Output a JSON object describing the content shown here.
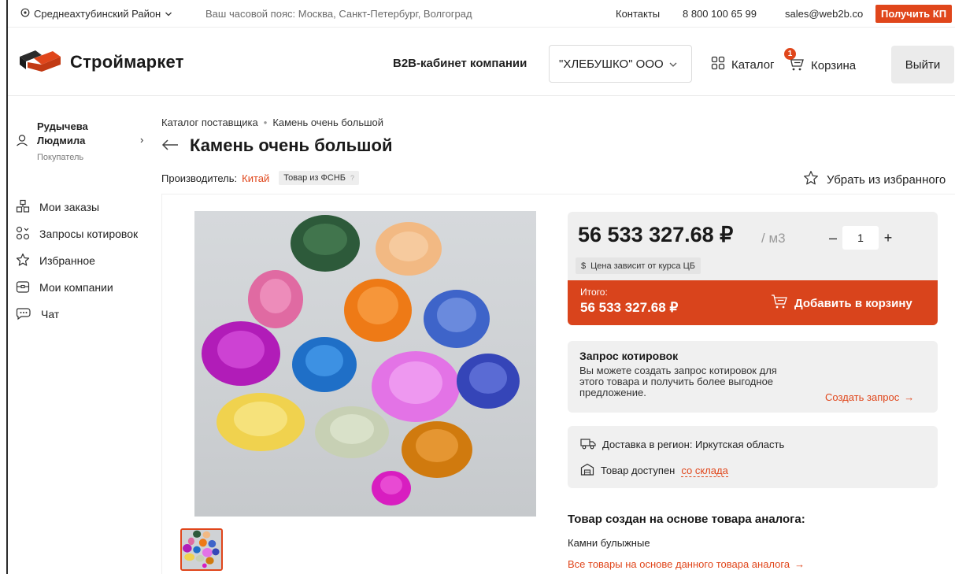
{
  "topbar": {
    "region": "Среднеахтубинский Район",
    "timezone": "Ваш часовой пояс: Москва, Санкт-Петербург, Волгоград",
    "contacts": "Контакты",
    "phone": "8 800 100 65 99",
    "email": "sales@web2b.co",
    "kp_button": "Получить КП"
  },
  "header": {
    "logo_text": "Строймаркет",
    "b2b_label": "B2B-кабинет компании",
    "company": "\"ХЛЕБУШКО\" ООО",
    "catalog": "Каталог",
    "cart": "Корзина",
    "cart_count": "1",
    "logout": "Выйти"
  },
  "user": {
    "name_line1": "Рудычева",
    "name_line2": "Людмила",
    "role": "Покупатель"
  },
  "sidebar": {
    "items": [
      {
        "label": "Мои заказы",
        "icon": "orders-icon"
      },
      {
        "label": "Запросы котировок",
        "icon": "quotes-icon"
      },
      {
        "label": "Избранное",
        "icon": "star-icon"
      },
      {
        "label": "Мои компании",
        "icon": "company-icon"
      },
      {
        "label": "Чат",
        "icon": "chat-icon"
      }
    ]
  },
  "breadcrumb": {
    "items": [
      "Каталог поставщика",
      "Камень очень большой"
    ],
    "separator": "•"
  },
  "product": {
    "title": "Камень очень большой",
    "maker_label": "Производитель:",
    "maker": "Китай",
    "tag": "Товар из ФСНБ",
    "tag_hint": "?",
    "favorite": "Убрать из избранного"
  },
  "price": {
    "value": "56 533 327.68 ₽",
    "unit": "/ м3",
    "qty": "1",
    "qty_minus": "–",
    "qty_plus": "+",
    "note_symbol": "$",
    "note": "Цена зависит от курса ЦБ",
    "total_label": "Итого:",
    "total_value": "56 533 327.68 ₽",
    "add_to_cart": "Добавить в корзину"
  },
  "quote": {
    "title": "Запрос котировок",
    "text": "Вы можете создать запрос котировок для этого товара и получить более выгодное предложение.",
    "link": "Создать запрос",
    "arrow": "→"
  },
  "delivery": {
    "region_text": "Доставка в регион: Иркутская область",
    "stock_text": "Товар доступен",
    "stock_link": "со склада"
  },
  "analog": {
    "title": "Товар создан на основе товара аналога:",
    "name": "Камни булыжные",
    "link": "Все товары на основе данного товара аналога",
    "arrow": "→"
  },
  "colors": {
    "accent": "#e0461b",
    "accent_dark": "#d9441c"
  }
}
